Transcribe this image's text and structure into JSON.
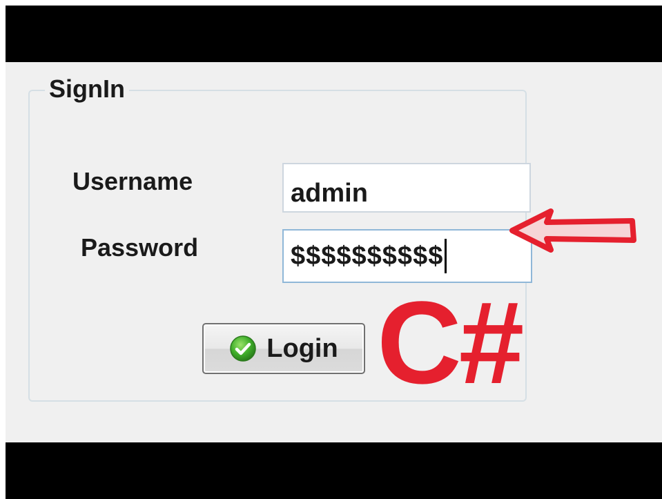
{
  "group": {
    "title": "SignIn"
  },
  "fields": {
    "username_label": "Username",
    "username_value": "admin",
    "password_label": "Password",
    "password_value": "$$$$$$$$$$"
  },
  "login_button": {
    "label": "Login",
    "icon": "check-icon"
  },
  "overlay": {
    "brand_text": "C#",
    "brand_color": "#e5202e",
    "arrow_icon": "left-arrow-icon"
  },
  "colors": {
    "letterbox": "#000000",
    "form_background": "#f0f0f0",
    "accent_red": "#e5202e"
  }
}
